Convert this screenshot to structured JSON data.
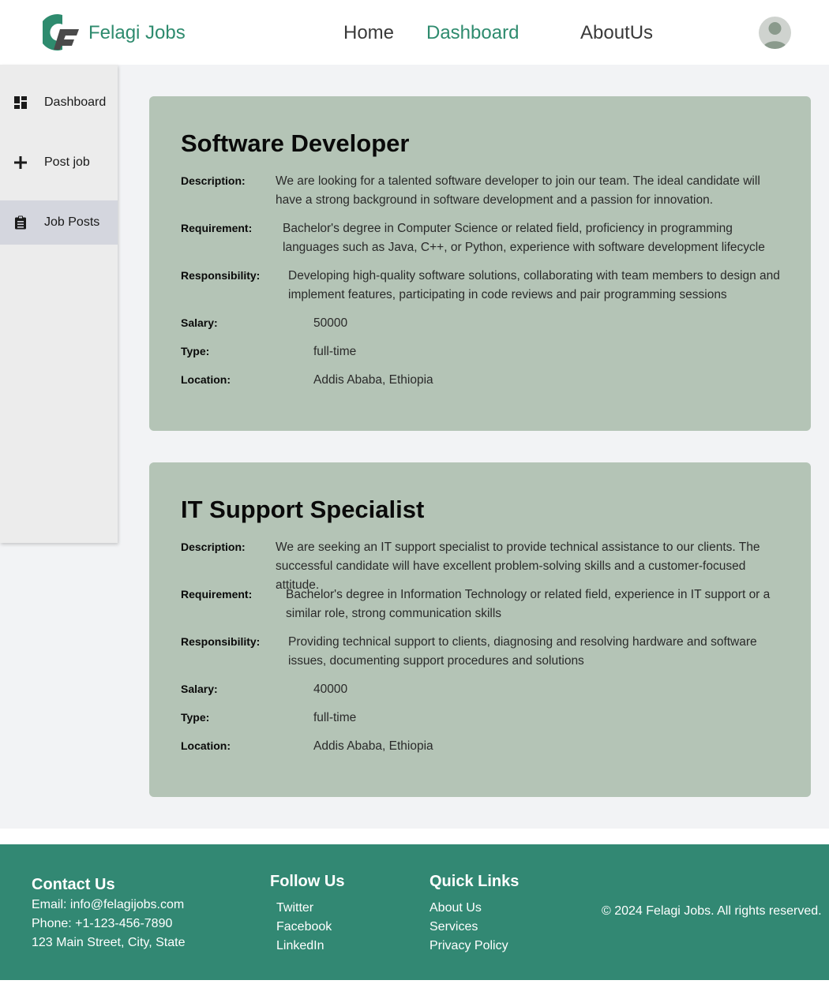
{
  "header": {
    "brand": "Felagi Jobs",
    "nav": {
      "home": "Home",
      "dashboard": "Dashboard",
      "about": "AboutUs"
    }
  },
  "sidebar": {
    "items": [
      {
        "label": "Dashboard",
        "icon": "dashboard-icon"
      },
      {
        "label": "Post job",
        "icon": "plus-icon"
      },
      {
        "label": "Job Posts",
        "icon": "clipboard-icon",
        "active": true
      }
    ]
  },
  "labels": {
    "description": "Description:",
    "requirement": "Requirement:",
    "responsibility": "Responsibility:",
    "salary": "Salary:",
    "type": "Type:",
    "location": "Location:"
  },
  "jobs": [
    {
      "title": "Software Developer",
      "description": "We are looking for a talented software developer to join our team. The ideal candidate will have a strong background in software development and a passion for innovation.",
      "requirement": "Bachelor's degree in Computer Science or related field, proficiency in programming languages such as Java, C++, or Python, experience with software development lifecycle",
      "responsibility": "Developing high-quality software solutions, collaborating with team members to design and implement features, participating in code reviews and pair programming sessions",
      "salary": "50000",
      "type": "full-time",
      "location": "Addis Ababa, Ethiopia"
    },
    {
      "title": "IT Support Specialist",
      "description": "We are seeking an IT support specialist to provide technical assistance to our clients. The successful candidate will have excellent problem-solving skills and a customer-focused attitude.",
      "requirement": "Bachelor's degree in Information Technology or related field, experience in IT support or a similar role, strong communication skills",
      "responsibility": "Providing technical support to clients, diagnosing and resolving hardware and software issues, documenting support procedures and solutions",
      "salary": "40000",
      "type": "full-time",
      "location": "Addis Ababa, Ethiopia"
    }
  ],
  "footer": {
    "contact": {
      "title": "Contact Us",
      "email": "Email: info@felagijobs.com",
      "phone": "Phone: +1-123-456-7890",
      "address": "123 Main Street, City, State"
    },
    "follow": {
      "title": "Follow Us",
      "links": [
        "Twitter",
        "Facebook",
        "LinkedIn"
      ]
    },
    "quick": {
      "title": "Quick Links",
      "links": [
        "About Us",
        "Services",
        "Privacy Policy"
      ]
    },
    "copyright": "© 2024 Felagi Jobs. All rights reserved."
  },
  "colors": {
    "brand": "#2e8b6e",
    "card": "#b4c4b6",
    "footer": "#328873"
  }
}
